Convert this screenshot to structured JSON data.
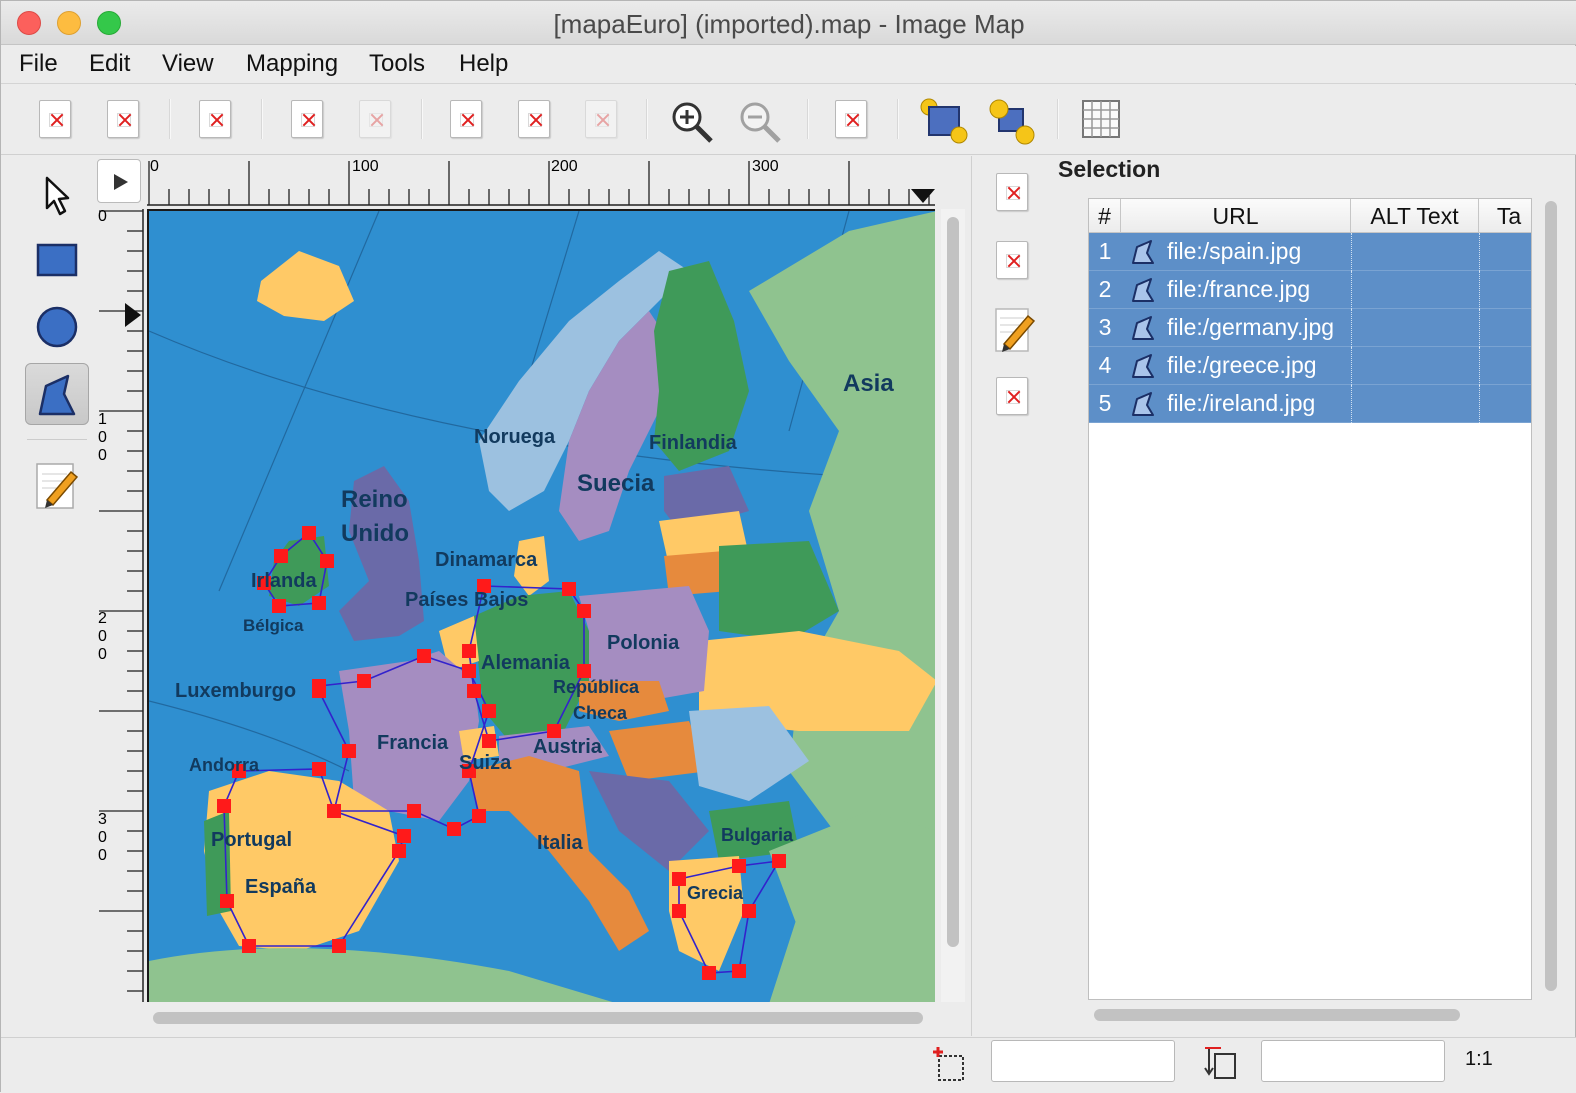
{
  "window": {
    "title": "[mapaEuro] (imported).map - Image Map"
  },
  "menubar": {
    "items": [
      "File",
      "Edit",
      "View",
      "Mapping",
      "Tools",
      "Help"
    ]
  },
  "toolbar": {
    "icons": [
      "doc-new-icon",
      "doc-open-icon",
      "doc-save-icon",
      "doc-preferences-icon",
      "doc-disabled-icon",
      "doc-undo-icon",
      "doc-redo-icon",
      "doc-disabled-icon",
      "zoom-in-icon",
      "zoom-out-icon",
      "doc-edit-map-icon",
      "raise-area-icon",
      "lower-area-icon",
      "grid-icon"
    ]
  },
  "left_tools": {
    "icons": [
      "arrow-pointer-icon",
      "rectangle-icon",
      "circle-icon",
      "polygon-icon",
      "edit-pencil-icon"
    ],
    "active": "polygon-icon"
  },
  "ruler": {
    "horizontal": [
      "0",
      "100",
      "200",
      "300"
    ],
    "vertical": [
      "0",
      "1\n0\n0",
      "2\n0\n0",
      "3\n0\n0"
    ]
  },
  "map": {
    "labels": {
      "asia": "Asia",
      "noruega": "Noruega",
      "finlandia": "Finlandia",
      "suecia": "Suecia",
      "reino": "Reino",
      "unido": "Unido",
      "dinamarca": "Dinamarca",
      "irlanda": "Irlanda",
      "paises_bajos": "Países Bajos",
      "belgica": "Bélgica",
      "polonia": "Polonia",
      "alemania": "Alemania",
      "luxemburgo": "Luxemburgo",
      "republica": "República",
      "checa": "Checa",
      "francia": "Francia",
      "austria": "Austria",
      "suiza": "Suiza",
      "andorra": "Andorra",
      "portugal": "Portugal",
      "espana": "España",
      "italia": "Italia",
      "bulgaria": "Bulgaria",
      "grecia": "Grecia"
    }
  },
  "selection": {
    "title": "Selection",
    "columns": [
      "#",
      "URL",
      "ALT Text",
      "Ta"
    ],
    "rows": [
      {
        "num": "1",
        "url": "file:/spain.jpg",
        "alt": "",
        "target": ""
      },
      {
        "num": "2",
        "url": "file:/france.jpg",
        "alt": "",
        "target": ""
      },
      {
        "num": "3",
        "url": "file:/germany.jpg",
        "alt": "",
        "target": ""
      },
      {
        "num": "4",
        "url": "file:/greece.jpg",
        "alt": "",
        "target": ""
      },
      {
        "num": "5",
        "url": "file:/ireland.jpg",
        "alt": "",
        "target": ""
      }
    ],
    "side_buttons": [
      "add-area-icon",
      "remove-area-icon",
      "edit-area-icon",
      "delete-area-icon"
    ]
  },
  "statusbar": {
    "zoom": "1:1",
    "coord_value": "",
    "size_value": ""
  },
  "colors": {
    "selection_row": "#5d8fc8",
    "sea": "#2f8fd0",
    "handle": "#ff1a1a",
    "polygon_line": "#3322cc"
  }
}
